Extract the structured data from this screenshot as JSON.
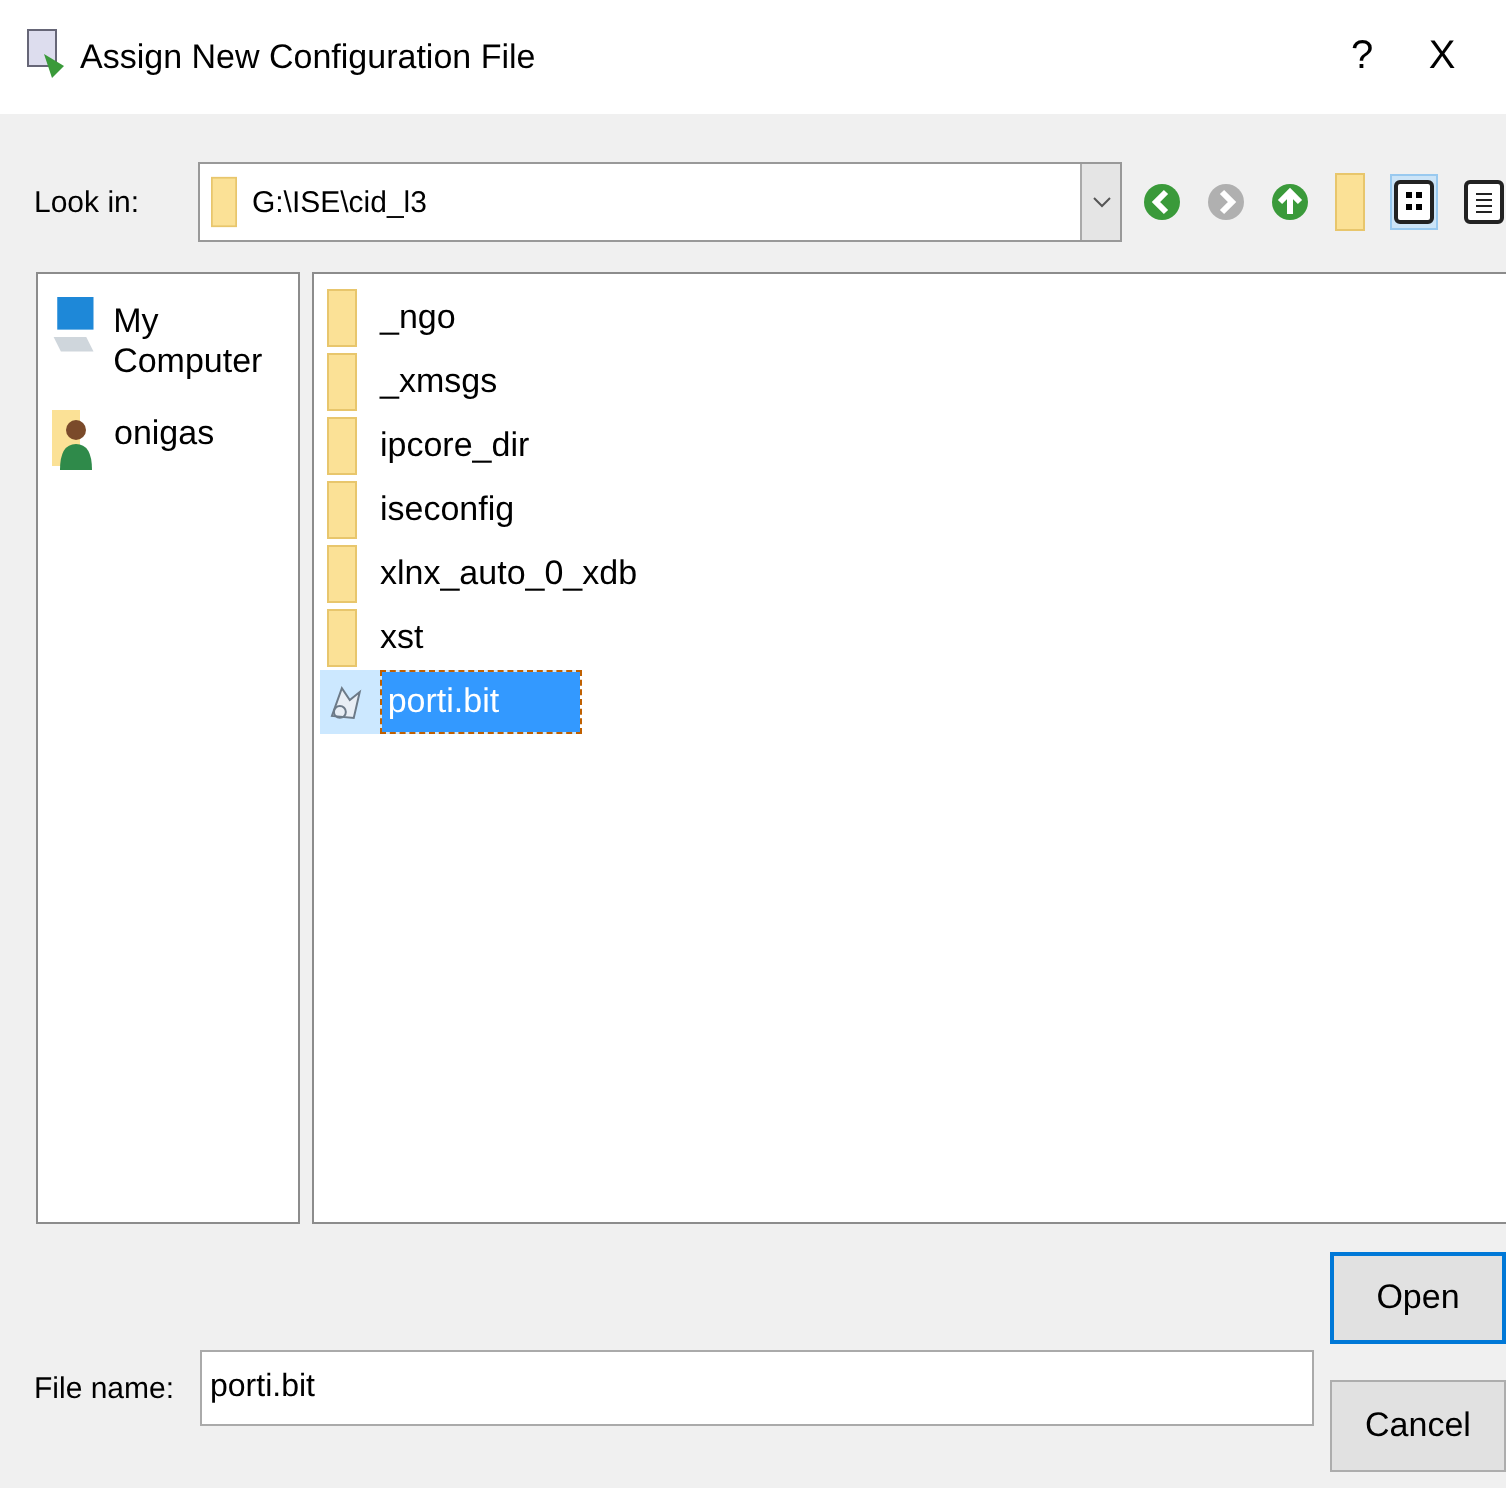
{
  "window": {
    "title": "Assign New Configuration File",
    "help": "?",
    "close": "X"
  },
  "look_in": {
    "label": "Look in:",
    "path": "G:\\ISE\\cid_l3"
  },
  "places": [
    {
      "label": "My Computer",
      "kind": "computer"
    },
    {
      "label": "onigas",
      "kind": "user"
    }
  ],
  "files": [
    {
      "name": "_ngo",
      "kind": "folder",
      "selected": false
    },
    {
      "name": "_xmsgs",
      "kind": "folder",
      "selected": false
    },
    {
      "name": "ipcore_dir",
      "kind": "folder",
      "selected": false
    },
    {
      "name": "iseconfig",
      "kind": "folder",
      "selected": false
    },
    {
      "name": "xlnx_auto_0_xdb",
      "kind": "folder",
      "selected": false
    },
    {
      "name": "xst",
      "kind": "folder",
      "selected": false
    },
    {
      "name": "porti.bit",
      "kind": "file",
      "selected": true
    }
  ],
  "file_name": {
    "label": "File name:",
    "value": "porti.bit"
  },
  "buttons": [
    {
      "label": "Open",
      "default": true
    },
    {
      "label": "Cancel",
      "default": false
    }
  ]
}
